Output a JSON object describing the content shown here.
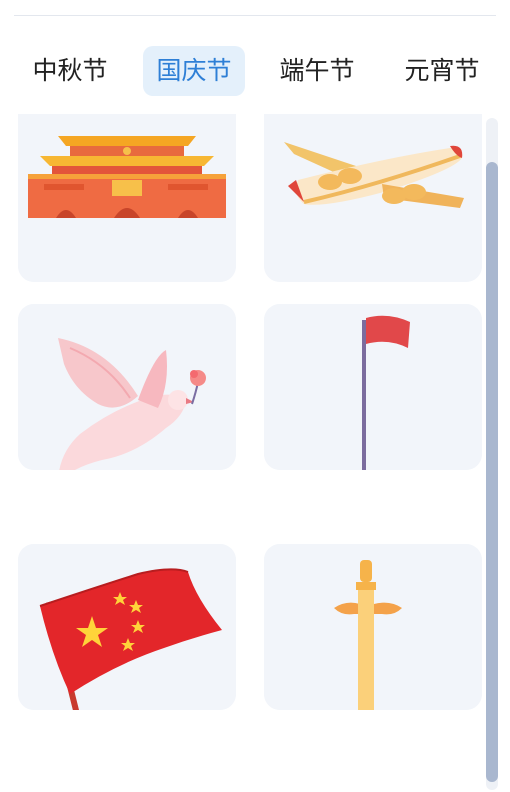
{
  "tabs": [
    {
      "label": "中秋节",
      "active": false
    },
    {
      "label": "国庆节",
      "active": true
    },
    {
      "label": "端午节",
      "active": false
    },
    {
      "label": "元宵节",
      "active": false
    }
  ],
  "colors": {
    "accent": "#2e7fd6",
    "active_tab_bg": "#e4f0fb",
    "card_bg": "#f2f5fa",
    "scroll_thumb": "#a9b7cf"
  },
  "stickers": [
    {
      "icon": "tiananmen-gate-icon"
    },
    {
      "icon": "airplane-icon"
    },
    {
      "icon": "peace-dove-icon"
    },
    {
      "icon": "flagpole-icon"
    },
    {
      "icon": "china-flag-icon"
    },
    {
      "icon": "huabiao-pillar-icon"
    }
  ]
}
